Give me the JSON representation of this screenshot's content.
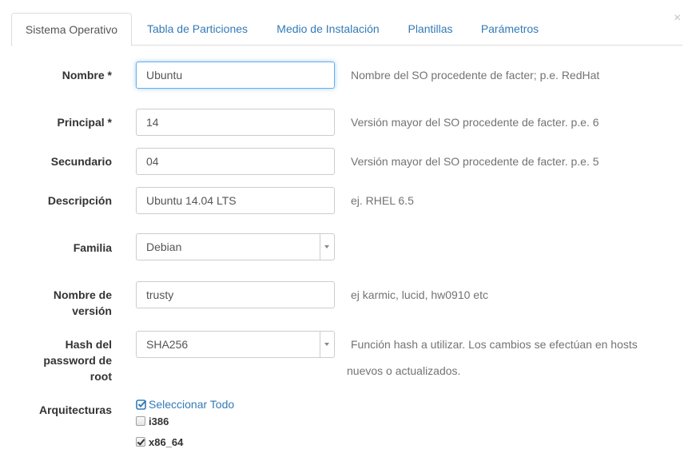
{
  "dialog": {
    "close_symbol": "×"
  },
  "tabs": [
    {
      "label": "Sistema Operativo",
      "active": true
    },
    {
      "label": "Tabla de Particiones"
    },
    {
      "label": "Medio de Instalación"
    },
    {
      "label": "Plantillas"
    },
    {
      "label": "Parámetros"
    }
  ],
  "form": {
    "nombre": {
      "label": "Nombre",
      "required": "*",
      "value": "Ubuntu",
      "help": "Nombre del SO procedente de facter; p.e. RedHat"
    },
    "principal": {
      "label": "Principal",
      "required": "*",
      "value": "14",
      "help": "Versión mayor del SO procedente de facter. p.e. 6"
    },
    "secundario": {
      "label": "Secundario",
      "value": "04",
      "help": "Versión mayor del SO procedente de facter. p.e. 5"
    },
    "descripcion": {
      "label": "Descripción",
      "value": "Ubuntu 14.04 LTS",
      "help": "ej. RHEL 6.5"
    },
    "familia": {
      "label": "Familia",
      "value": "Debian"
    },
    "nombre_version": {
      "label_line1": "Nombre de",
      "label_line2": "versión",
      "value": "trusty",
      "help": "ej karmic, lucid, hw0910 etc"
    },
    "hash": {
      "label_line1": "Hash del",
      "label_line2": "password de",
      "label_line3": "root",
      "value": "SHA256",
      "help_line1": "Función hash a utilizar. Los cambios se efectúan en hosts",
      "help_line2": "nuevos o actualizados."
    },
    "arquitecturas": {
      "label": "Arquitecturas",
      "select_all": "Seleccionar Todo",
      "options": [
        {
          "label": "i386",
          "checked": false
        },
        {
          "label": "x86_64",
          "checked": true
        }
      ]
    }
  }
}
